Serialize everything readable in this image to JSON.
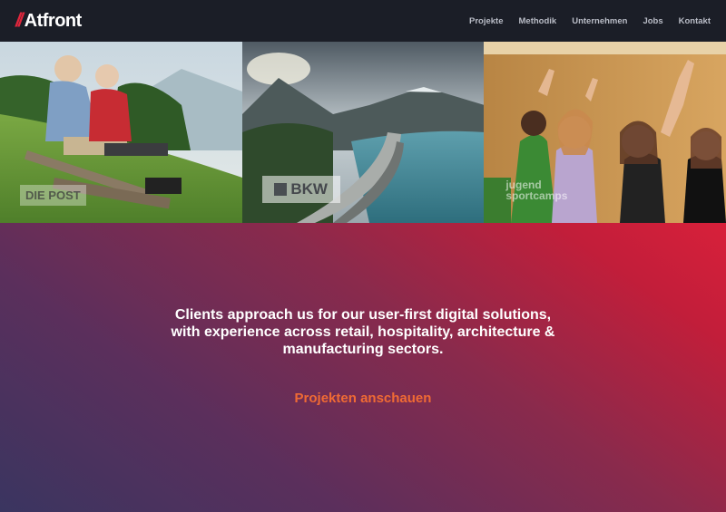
{
  "brand": {
    "slashes": "//",
    "name": "Atfront",
    "accent": "#e0263c"
  },
  "nav": {
    "items": [
      {
        "label": "Projekte"
      },
      {
        "label": "Methodik"
      },
      {
        "label": "Unternehmen"
      },
      {
        "label": "Jobs"
      },
      {
        "label": "Kontakt"
      }
    ]
  },
  "gallery": {
    "tiles": [
      {
        "client_logo": "DIE POST"
      },
      {
        "client_logo": "BKW"
      },
      {
        "client_logo_line1": "jugend",
        "client_logo_line2": "sportcamps"
      }
    ]
  },
  "hero": {
    "text": "Clients approach us for our user-first digital solutions, with experience across retail, hospitality, architecture & manufacturing sectors.",
    "cta_label": "Projekten anschauen",
    "cta_color": "#f06a34"
  }
}
